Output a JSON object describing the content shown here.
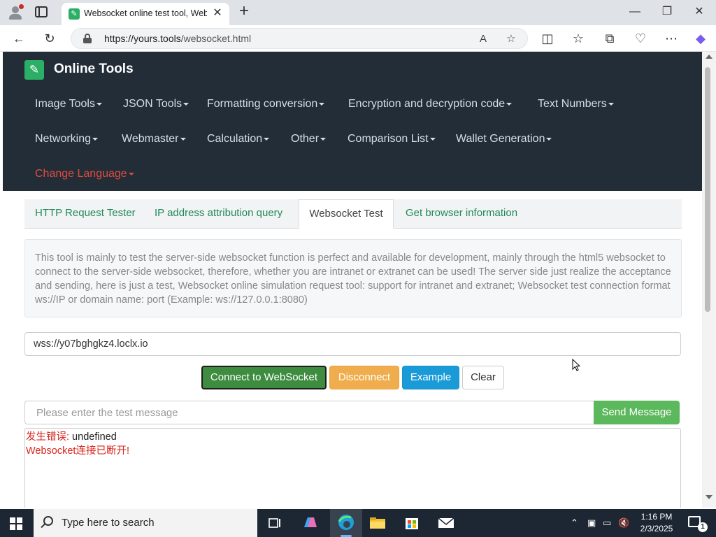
{
  "browser": {
    "tab_title": "Websocket online test tool, Webs",
    "url_prefix": "https://",
    "url_host": "yours.tools",
    "url_path": "/websocket.html"
  },
  "site": {
    "brand": "Online Tools",
    "menu": [
      {
        "label": "Image Tools"
      },
      {
        "label": "JSON Tools"
      },
      {
        "label": "Formatting conversion"
      },
      {
        "label": "Encryption and decryption code"
      },
      {
        "label": "Text Numbers"
      },
      {
        "label": "Networking"
      },
      {
        "label": "Webmaster"
      },
      {
        "label": "Calculation"
      },
      {
        "label": "Other"
      },
      {
        "label": "Comparison List"
      },
      {
        "label": "Wallet Generation"
      }
    ],
    "language_label": "Change Language",
    "colors": {
      "navbar": "#222d38",
      "brand_green": "#2bae66",
      "language": "#e04b3f"
    }
  },
  "tabs": [
    {
      "label": "HTTP Request Tester"
    },
    {
      "label": "IP address attribution query"
    },
    {
      "label": "Websocket Test",
      "active": true
    },
    {
      "label": "Get browser information"
    }
  ],
  "notice": "This tool is mainly to test the server-side websocket function is perfect and available for development, mainly through the html5 websocket to connect to the server-side websocket, therefore, whether you are intranet or extranet can be used! The server side just realize the acceptance and sending, here is just a test, Websocket online simulation request tool: support for intranet and extranet; Websocket test connection format ws://IP or domain name: port (Example: ws://127.0.0.1:8080)",
  "ws_url": "wss://y07bghgkz4.loclx.io",
  "buttons": {
    "connect": "Connect to WebSocket",
    "disconnect": "Disconnect",
    "example": "Example",
    "clear": "Clear",
    "send": "Send Message"
  },
  "message_placeholder": "Please enter the test message",
  "log": {
    "line1_label": "发生错误:",
    "line1_value": " undefined",
    "line2": "Websocket连接已断开!"
  },
  "taskbar": {
    "search_placeholder": "Type here to search",
    "time": "1:16 PM",
    "date": "2/3/2025",
    "notification_count": "1"
  }
}
